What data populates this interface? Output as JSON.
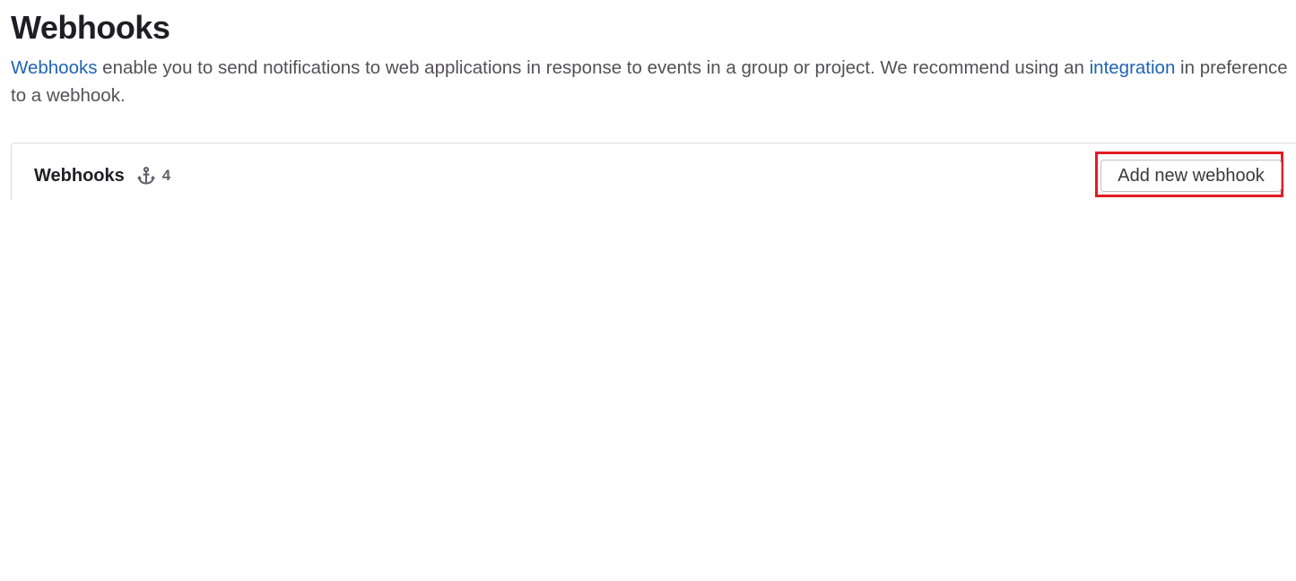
{
  "page": {
    "title": "Webhooks",
    "description": {
      "link1": "Webhooks",
      "text1": " enable you to send notifications to web applications in response to events in a group or project. We recommend using an ",
      "link2": "integration",
      "text2": " in preference to a webhook."
    }
  },
  "card": {
    "title": "Webhooks",
    "icon": "webhook-anchor-icon",
    "count": "4",
    "add_button_label": "Add new webhook"
  },
  "colors": {
    "link": "#1f63b5",
    "highlight": "#e31b23"
  }
}
